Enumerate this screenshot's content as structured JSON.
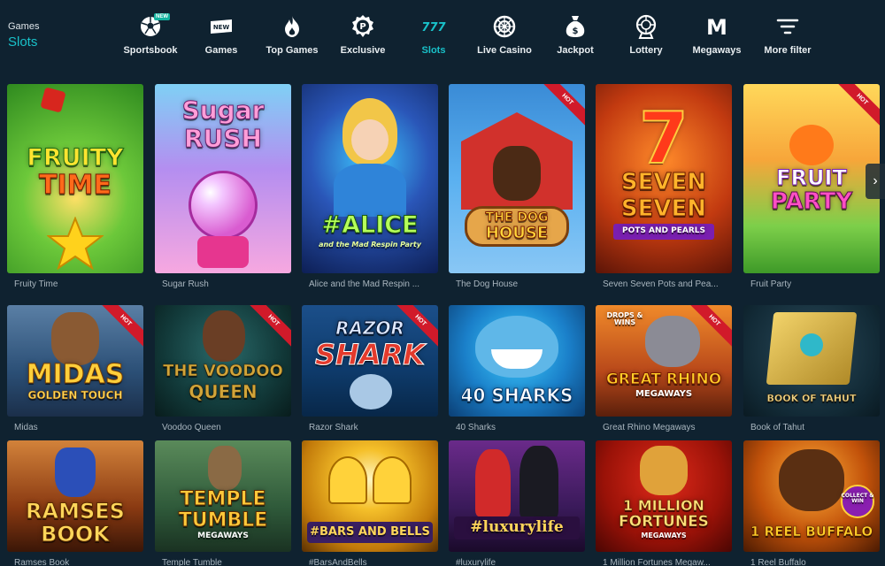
{
  "breadcrumb": {
    "parent": "Games",
    "current": "Slots"
  },
  "nav": {
    "items": [
      {
        "label": "Sportsbook",
        "icon": "soccer-ball-icon",
        "badge": "NEW"
      },
      {
        "label": "Games",
        "icon": "new-tag-icon",
        "badge": ""
      },
      {
        "label": "Top Games",
        "icon": "flame-icon",
        "badge": ""
      },
      {
        "label": "Exclusive",
        "icon": "exclusive-badge-icon",
        "badge": ""
      },
      {
        "label": "Slots",
        "icon": "slots-777-icon",
        "badge": "",
        "active": true
      },
      {
        "label": "Live Casino",
        "icon": "roulette-wheel-icon",
        "badge": ""
      },
      {
        "label": "Jackpot",
        "icon": "money-bag-icon",
        "badge": ""
      },
      {
        "label": "Lottery",
        "icon": "lottery-ball-icon",
        "badge": ""
      },
      {
        "label": "Megaways",
        "icon": "megaways-m-icon",
        "badge": ""
      },
      {
        "label": "More filter",
        "icon": "filter-lines-icon",
        "badge": ""
      }
    ],
    "new_icon_text": "NEW",
    "slots_icon_text": "777",
    "megaways_icon_text": "M"
  },
  "hot_label": "HOT",
  "games": [
    {
      "name": "Fruity Time",
      "art": [
        "FRUITY",
        "TIME"
      ],
      "hot": false
    },
    {
      "name": "Sugar Rush",
      "art": [
        "Sugar",
        "RUSH"
      ],
      "hot": false
    },
    {
      "name": "Alice and the Mad Respin ...",
      "art": [
        "#ALICE",
        "and the Mad Respin Party"
      ],
      "hot": false
    },
    {
      "name": "The Dog House",
      "art": [
        "THE DOG",
        "HOUSE"
      ],
      "hot": true
    },
    {
      "name": "Seven Seven Pots and Pea...",
      "art": [
        "SEVEN",
        "SEVEN",
        "POTS AND PEARLS"
      ],
      "hot": false
    },
    {
      "name": "Fruit Party",
      "art": [
        "FRUIT",
        "PARTY"
      ],
      "hot": true
    },
    {
      "name": "Midas",
      "art": [
        "MIDAS",
        "GOLDEN TOUCH"
      ],
      "hot": true
    },
    {
      "name": "Voodoo Queen",
      "art": [
        "THE VOODOO",
        "QUEEN"
      ],
      "hot": true
    },
    {
      "name": "Razor Shark",
      "art": [
        "RAZOR",
        "SHARK"
      ],
      "hot": true
    },
    {
      "name": "40 Sharks",
      "art": [
        "40 SHARKS"
      ],
      "hot": false
    },
    {
      "name": "Great Rhino Megaways",
      "art": [
        "DROPS & WINS",
        "GREAT RHINO",
        "MEGAWAYS"
      ],
      "hot": true
    },
    {
      "name": "Book of Tahut",
      "art": [
        "BOOK OF TAHUT"
      ],
      "hot": false
    },
    {
      "name": "Ramses Book",
      "art": [
        "RAMSES",
        "BOOK"
      ],
      "hot": false
    },
    {
      "name": "Temple Tumble",
      "art": [
        "TEMPLE",
        "TUMBLE",
        "MEGAWAYS"
      ],
      "hot": false
    },
    {
      "name": "#BarsAndBells",
      "art": [
        "#BARS AND BELLS"
      ],
      "hot": false
    },
    {
      "name": "#luxurylife",
      "art": [
        "#luxurylife"
      ],
      "hot": false
    },
    {
      "name": "1 Million Fortunes Megaw...",
      "art": [
        "1 MILLION",
        "FORTUNES",
        "MEGAWAYS"
      ],
      "hot": false
    },
    {
      "name": "1 Reel Buffalo",
      "art": [
        "1 REEL BUFFALO",
        "COLLECT & WIN"
      ],
      "hot": false
    }
  ],
  "colors": {
    "background": "#0f2230",
    "accent": "#19c1c9",
    "hot": "#d11a2a"
  },
  "next_arrow": "›"
}
